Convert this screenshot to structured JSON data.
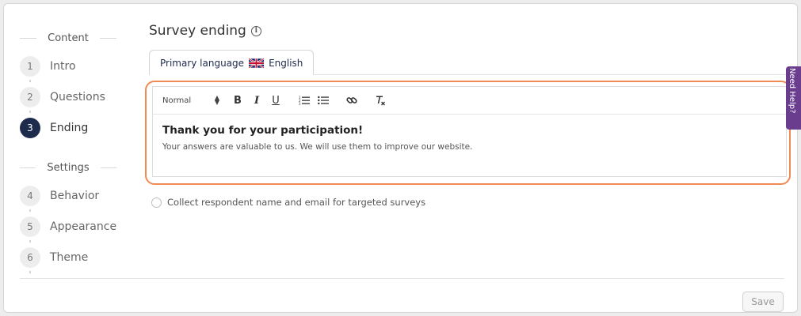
{
  "sidebar": {
    "content_label": "Content",
    "settings_label": "Settings",
    "steps": [
      {
        "num": "1",
        "label": "Intro"
      },
      {
        "num": "2",
        "label": "Questions"
      },
      {
        "num": "3",
        "label": "Ending"
      },
      {
        "num": "4",
        "label": "Behavior"
      },
      {
        "num": "5",
        "label": "Appearance"
      },
      {
        "num": "6",
        "label": "Theme"
      }
    ],
    "active_step": "3"
  },
  "main": {
    "title": "Survey ending",
    "tab": {
      "prefix": "Primary language",
      "language": "English",
      "flag_icon": "uk-flag-icon"
    },
    "editor": {
      "format_select": "Normal",
      "heading": "Thank you for your participation!",
      "body": "Your answers are valuable to us. We will use them to improve our website."
    },
    "checkbox_label": "Collect respondent name and email for targeted surveys",
    "checkbox_checked": false,
    "save_label": "Save"
  },
  "help_tab": {
    "label": "Need Help?"
  },
  "colors": {
    "active_step": "#1d2b4d",
    "highlight": "#f08a55",
    "help_tab": "#6a3d8f"
  }
}
